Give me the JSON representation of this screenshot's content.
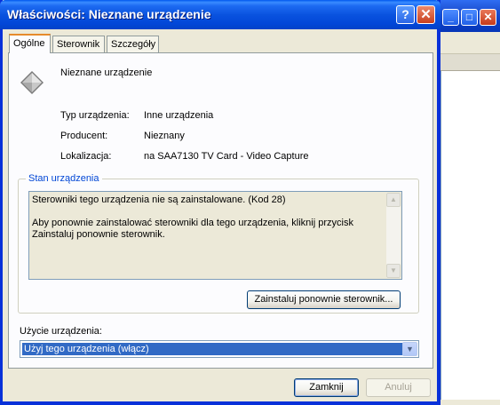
{
  "window_title": "Właściwości: Nieznane urządzenie",
  "titlebar": {
    "help_glyph": "?",
    "close_glyph": "✕"
  },
  "background_window": {
    "minimize_glyph": "_",
    "maximize_glyph": "□",
    "close_glyph": "✕"
  },
  "tabs": [
    {
      "label": "Ogólne",
      "active": true
    },
    {
      "label": "Sterownik",
      "active": false
    },
    {
      "label": "Szczegóły",
      "active": false
    }
  ],
  "device": {
    "name": "Nieznane urządzenie",
    "icon": "unknown-device-icon",
    "properties": [
      {
        "label": "Typ urządzenia:",
        "value": "Inne urządzenia"
      },
      {
        "label": "Producent:",
        "value": "Nieznany"
      },
      {
        "label": "Lokalizacja:",
        "value": "na SAA7130 TV Card - Video Capture"
      }
    ]
  },
  "status": {
    "group_label": "Stan urządzenia",
    "text": "Sterowniki tego urządzenia nie są zainstalowane. (Kod 28)\n\nAby ponownie zainstalować sterowniki dla tego urządzenia, kliknij przycisk Zainstaluj ponownie sterownik.",
    "reinstall_button": "Zainstaluj ponownie sterownik..."
  },
  "usage": {
    "label": "Użycie urządzenia:",
    "selected": "Użyj tego urządzenia (włącz)"
  },
  "footer": {
    "close_label": "Zamknij",
    "cancel_label": "Anuluj"
  },
  "colors": {
    "accent": "#0831d9",
    "selection": "#316ac5",
    "tab_highlight": "#e68b2c",
    "group_label": "#0046d5"
  }
}
